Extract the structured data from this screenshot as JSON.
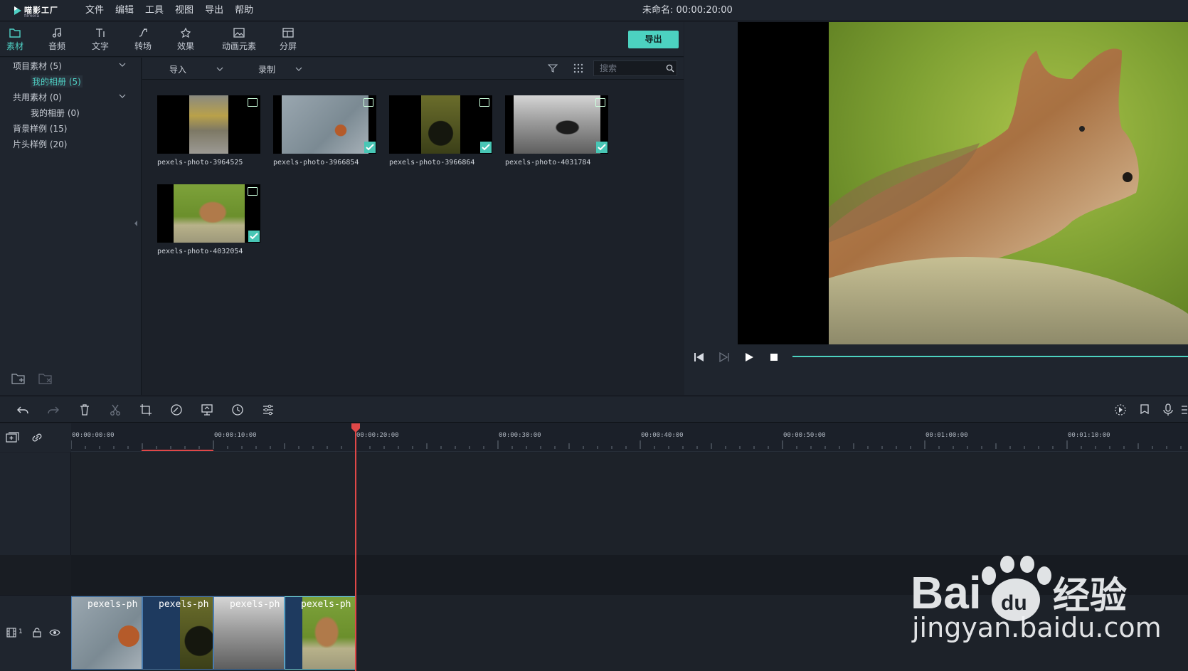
{
  "menubar": {
    "app_name": "喵影工厂",
    "app_sub": "filmora",
    "items": [
      "文件",
      "编辑",
      "工具",
      "视图",
      "导出",
      "帮助"
    ],
    "project_title": "未命名: 00:00:20:00"
  },
  "tabs": [
    {
      "label": "素材",
      "icon": "folder-icon"
    },
    {
      "label": "音频",
      "icon": "music-note-icon"
    },
    {
      "label": "文字",
      "icon": "text-icon"
    },
    {
      "label": "转场",
      "icon": "transition-icon"
    },
    {
      "label": "效果",
      "icon": "effects-icon"
    },
    {
      "label": "动画元素",
      "icon": "image-icon"
    },
    {
      "label": "分屏",
      "icon": "split-screen-icon"
    }
  ],
  "export_label": "导出",
  "library": {
    "items": [
      {
        "label": "项目素材 (5)",
        "expandable": true
      },
      {
        "label": "我的相册 (5)",
        "selected": true
      },
      {
        "label": "共用素材 (0)",
        "expandable": true
      },
      {
        "label": "我的相册 (0)"
      },
      {
        "label": "背景样例 (15)"
      },
      {
        "label": "片头样例 (20)"
      }
    ]
  },
  "media_toolbar": {
    "import_label": "导入",
    "record_label": "录制",
    "search_placeholder": "搜索"
  },
  "media": [
    {
      "name": "pexels-photo-3964525",
      "checked": false
    },
    {
      "name": "pexels-photo-3966854",
      "checked": true
    },
    {
      "name": "pexels-photo-3966864",
      "checked": true
    },
    {
      "name": "pexels-photo-4031784",
      "checked": true
    },
    {
      "name": "pexels-photo-4032054",
      "checked": true
    }
  ],
  "ruler_labels": [
    "00:00:00:00",
    "00:00:10:00",
    "00:00:20:00",
    "00:00:30:00",
    "00:00:40:00",
    "00:00:50:00",
    "00:01:00:00",
    "00:01:10:00"
  ],
  "timeline": {
    "track_number": "1",
    "clip_label": "pexels-ph"
  },
  "watermark": {
    "brand": "Baidu经验",
    "url": "jingyan.baidu.com"
  },
  "colors": {
    "accent": "#4cd2c0",
    "playhead": "#e04848",
    "clip": "#1e3a5f"
  }
}
